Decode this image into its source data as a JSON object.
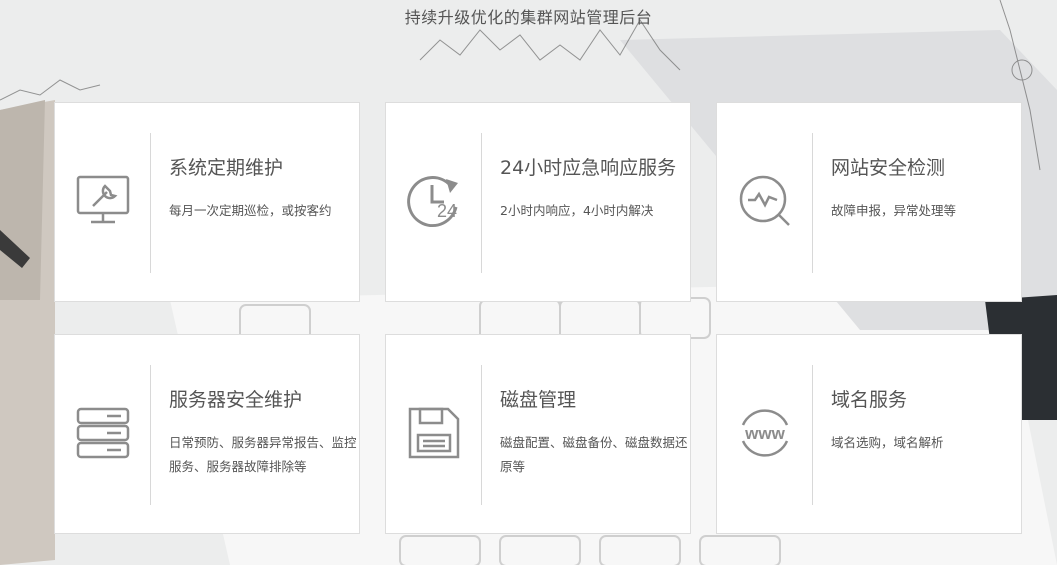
{
  "header": {
    "title": "持续升级优化的集群网站管理后台"
  },
  "cards": [
    {
      "title": "系统定期维护",
      "desc": "每月一次定期巡检，或按客约",
      "icon": "monitor-wrench-icon"
    },
    {
      "title": "24小时应急响应服务",
      "desc": "2小时内响应，4小时内解决",
      "icon": "clock-24-icon",
      "icon_text": "24"
    },
    {
      "title": "网站安全检测",
      "desc": "故障申报，异常处理等",
      "icon": "security-scan-icon"
    },
    {
      "title": "服务器安全维护",
      "desc": "日常预防、服务器异常报告、监控服务、服务器故障排除等",
      "icon": "server-rack-icon"
    },
    {
      "title": "磁盘管理",
      "desc": "磁盘配置、磁盘备份、磁盘数据还原等",
      "icon": "floppy-disk-icon"
    },
    {
      "title": "域名服务",
      "desc": "域名选购，域名解析",
      "icon": "www-globe-icon",
      "icon_text": "www"
    }
  ],
  "colors": {
    "icon": "#8c8c8c",
    "text": "#555555",
    "card_bg": "#ffffff"
  }
}
